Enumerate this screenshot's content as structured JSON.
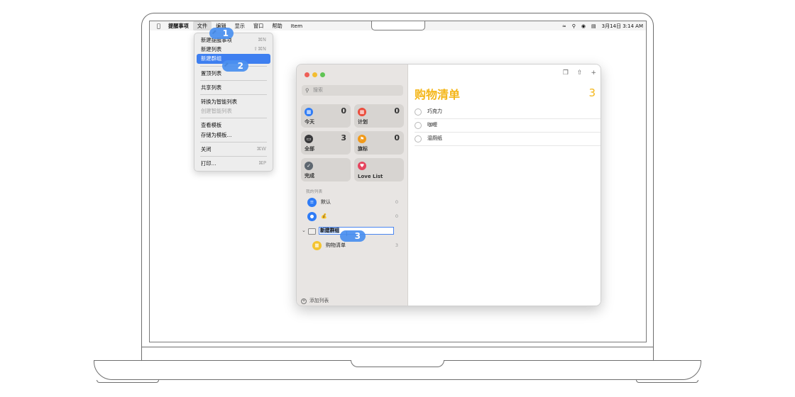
{
  "menubar": {
    "app": "提醒事项",
    "items": [
      "文件",
      "编辑",
      "显示",
      "窗口",
      "帮助",
      "Item"
    ],
    "datetime": "3月14日  3:14 AM"
  },
  "file_menu": {
    "items": [
      {
        "label": "新建提醒事项",
        "shortcut": "⌘N"
      },
      {
        "label": "新建列表",
        "shortcut": "⇧⌘N"
      },
      {
        "label": "新建群组",
        "highlighted": true
      },
      {
        "label": "置顶列表"
      },
      {
        "label": "共享列表"
      },
      {
        "label": "转换为智能列表"
      },
      {
        "label": "创建智能列表",
        "disabled": true
      },
      {
        "label": "查看模板"
      },
      {
        "label": "存储为模板..."
      },
      {
        "label": "关闭",
        "shortcut": "⌘W"
      },
      {
        "label": "打印...",
        "shortcut": "⌘P"
      }
    ]
  },
  "sidebar": {
    "search_placeholder": "搜索",
    "smart_lists": [
      {
        "label": "今天",
        "count": "0",
        "color": "#2f7cf6"
      },
      {
        "label": "计划",
        "count": "0",
        "color": "#eb4d3d"
      },
      {
        "label": "全部",
        "count": "3",
        "color": "#3a3a3c"
      },
      {
        "label": "旗标",
        "count": "0",
        "color": "#f19a1a"
      },
      {
        "label": "完成",
        "count": "",
        "color": "#5e6770"
      },
      {
        "label": "Love List",
        "count": "",
        "color": "#e5445e"
      }
    ],
    "section_label": "我的列表",
    "lists": [
      {
        "name": "默认",
        "count": "0",
        "color": "#2f7cf6"
      },
      {
        "name": "💰",
        "count": "0",
        "color": "#2f7cf6"
      }
    ],
    "group_name": "新建群组",
    "group_child": {
      "name": "购物清单",
      "count": "3",
      "color": "#f4c430"
    },
    "add_list": "添加列表"
  },
  "main": {
    "title": "购物清单",
    "count": "3",
    "reminders": [
      "巧克力",
      "咖喱",
      "湿厕纸"
    ]
  },
  "callouts": [
    "1",
    "2",
    "3"
  ]
}
